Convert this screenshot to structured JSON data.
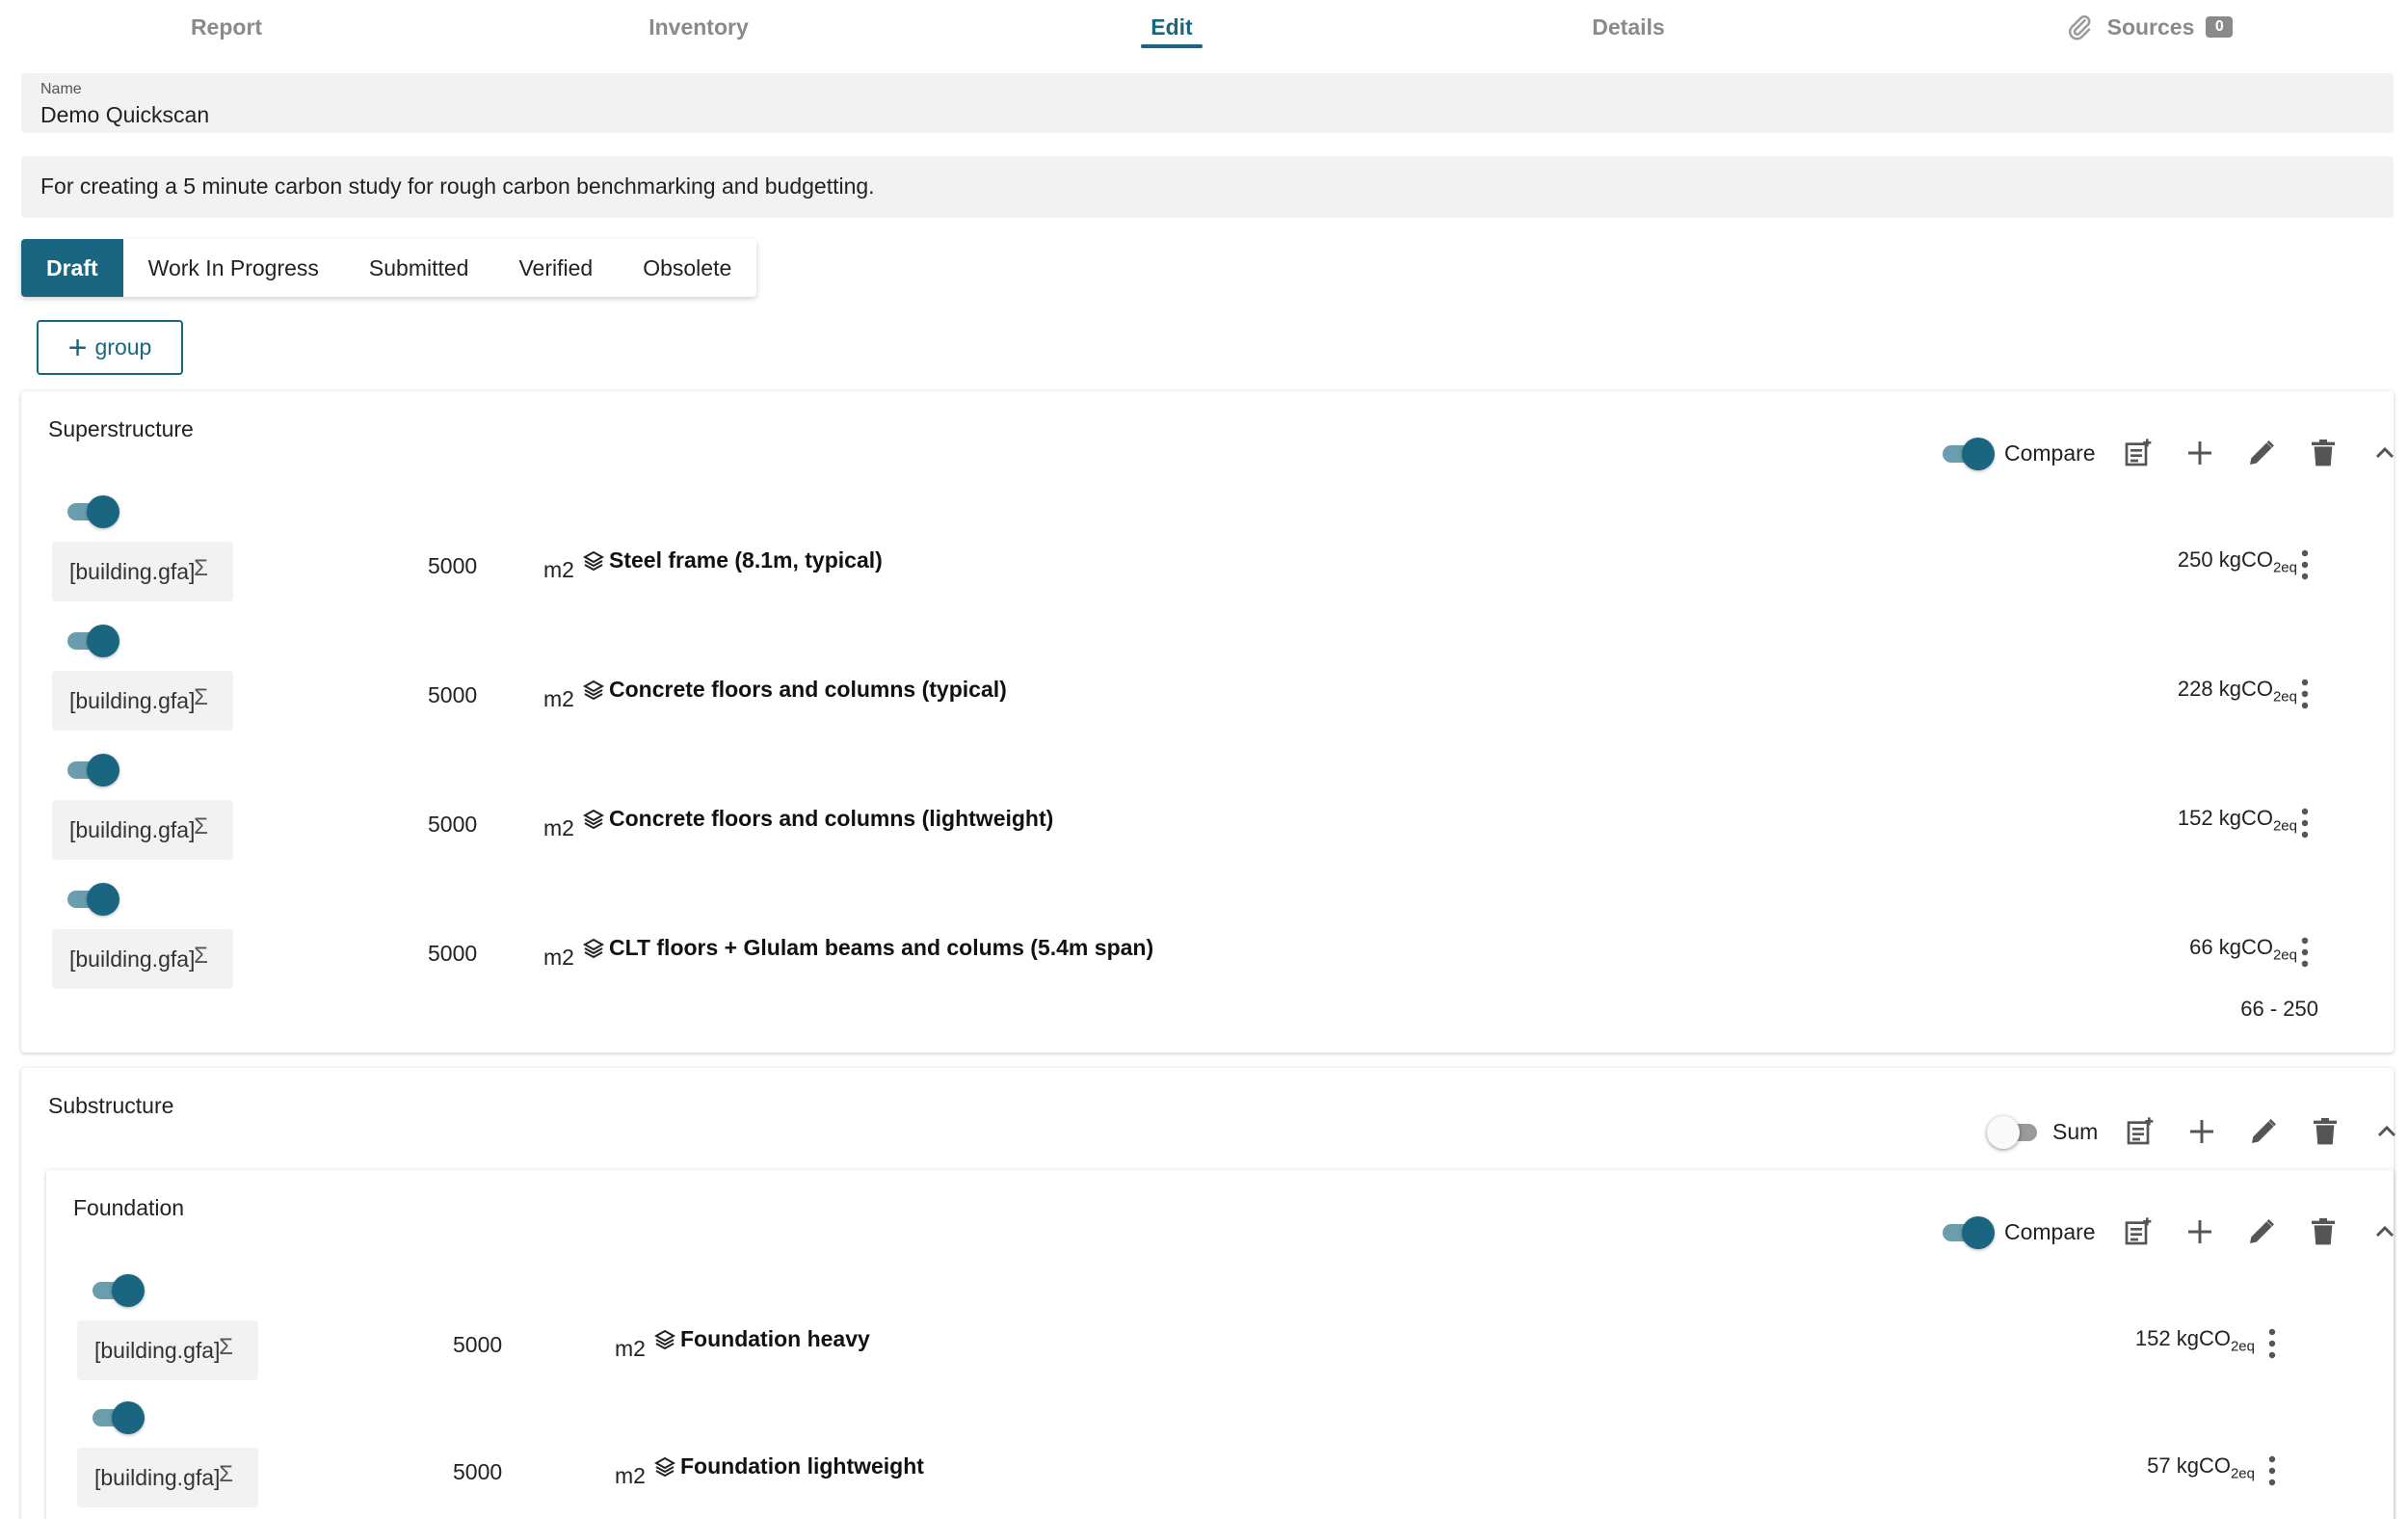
{
  "top_tabs": [
    {
      "label": "Report"
    },
    {
      "label": "Inventory"
    },
    {
      "label": "Edit"
    },
    {
      "label": "Details"
    },
    {
      "label": "Sources",
      "badge": "0"
    }
  ],
  "name_field": {
    "label": "Name",
    "value": "Demo Quickscan"
  },
  "description": "For creating a 5 minute carbon study for rough carbon benchmarking and budgetting.",
  "status_tabs": [
    "Draft",
    "Work In Progress",
    "Submitted",
    "Verified",
    "Obsolete"
  ],
  "group_button": {
    "plus": "+",
    "label": "group"
  },
  "superstructure": {
    "title": "Superstructure",
    "mode_label": "Compare",
    "items": [
      {
        "formula": "[building.gfa]",
        "sigma": "Σ",
        "amount": "5000",
        "unit": "m2",
        "name": "Steel frame (8.1m, typical)",
        "carbon_value": "250",
        "carbon_unit": "kgCO",
        "carbon_sub": "2eq"
      },
      {
        "formula": "[building.gfa]",
        "sigma": "Σ",
        "amount": "5000",
        "unit": "m2",
        "name": "Concrete floors and columns (typical)",
        "carbon_value": "228",
        "carbon_unit": "kgCO",
        "carbon_sub": "2eq"
      },
      {
        "formula": "[building.gfa]",
        "sigma": "Σ",
        "amount": "5000",
        "unit": "m2",
        "name": "Concrete floors and columns (lightweight)",
        "carbon_value": "152",
        "carbon_unit": "kgCO",
        "carbon_sub": "2eq"
      },
      {
        "formula": "[building.gfa]",
        "sigma": "Σ",
        "amount": "5000",
        "unit": "m2",
        "name": "CLT floors + Glulam beams and colums (5.4m span)",
        "carbon_value": "66",
        "carbon_unit": "kgCO",
        "carbon_sub": "2eq"
      }
    ],
    "range": "66 - 250"
  },
  "substructure": {
    "title": "Substructure",
    "mode_label": "Sum",
    "foundation": {
      "title": "Foundation",
      "mode_label": "Compare",
      "items": [
        {
          "formula": "[building.gfa]",
          "sigma": "Σ",
          "amount": "5000",
          "unit": "m2",
          "name": "Foundation heavy",
          "carbon_value": "152",
          "carbon_unit": "kgCO",
          "carbon_sub": "2eq"
        },
        {
          "formula": "[building.gfa]",
          "sigma": "Σ",
          "amount": "5000",
          "unit": "m2",
          "name": "Foundation lightweight",
          "carbon_value": "57",
          "carbon_unit": "kgCO",
          "carbon_sub": "2eq"
        }
      ]
    }
  },
  "colors": {
    "accent": "#1a6680",
    "toggle_track": "#6a9eae",
    "field_bg": "#f2f2f2",
    "tab_inactive": "#8a8a8a"
  },
  "icons": [
    "paperclip-icon",
    "plus-icon",
    "add-note-icon",
    "pencil-icon",
    "trash-icon",
    "chevron-up-icon",
    "layers-icon",
    "kebab-menu-icon",
    "sigma-icon"
  ]
}
